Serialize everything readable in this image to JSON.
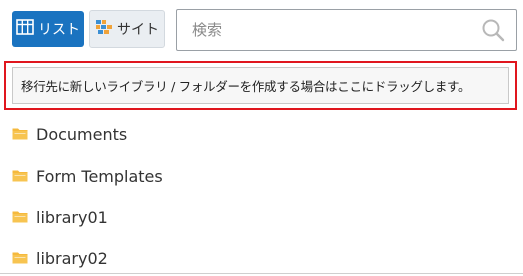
{
  "toolbar": {
    "list_button": {
      "label": "リスト",
      "icon": "list-view-icon"
    },
    "site_button": {
      "label": "サイト",
      "icon": "site-icon"
    },
    "search": {
      "placeholder": "検索",
      "value": "",
      "icon": "search-icon"
    }
  },
  "drop_zone": {
    "text": "移行先に新しいライブラリ / フォルダーを作成する場合はここにドラッグします。"
  },
  "folders": [
    {
      "name": "Documents",
      "icon": "folder-icon"
    },
    {
      "name": "Form Templates",
      "icon": "folder-icon"
    },
    {
      "name": "library01",
      "icon": "folder-icon"
    },
    {
      "name": "library02",
      "icon": "folder-icon"
    }
  ],
  "colors": {
    "primary": "#1a73c0",
    "highlight_border": "#e0161e",
    "folder": "#f5b93d"
  }
}
